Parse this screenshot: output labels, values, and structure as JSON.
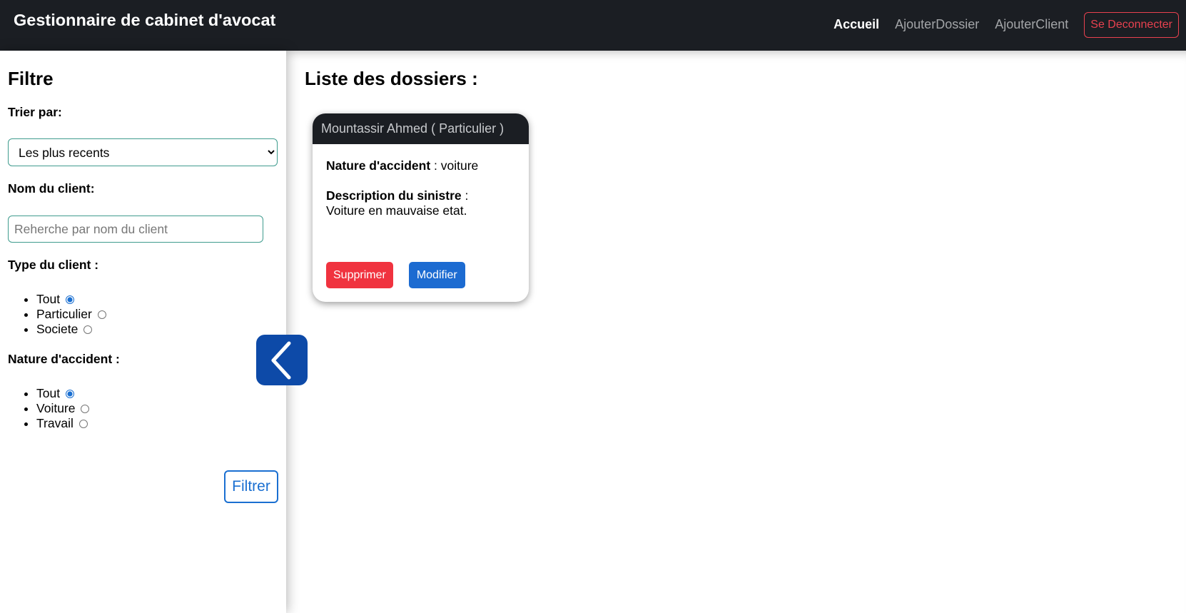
{
  "navbar": {
    "brand": "Gestionnaire de cabinet d'avocat",
    "links": [
      "Accueil",
      "AjouterDossier",
      "AjouterClient"
    ],
    "logout_label": "Se Deconnecter"
  },
  "sidebar": {
    "title": "Filtre",
    "sort_label": "Trier par:",
    "sort_value": "Les plus recents",
    "client_name_label": "Nom du client:",
    "search_placeholder": "Reherche par nom du client",
    "client_type_label": "Type du client :",
    "client_type_options": [
      "Tout",
      "Particulier",
      "Societe"
    ],
    "client_type_selected": "Tout",
    "accident_label": "Nature d'accident :",
    "accident_options": [
      "Tout",
      "Voiture",
      "Travail"
    ],
    "accident_selected": "Tout",
    "filter_button": "Filtrer",
    "toggle_icon": "chevron-left-icon"
  },
  "main": {
    "title": "Liste des dossiers :",
    "dossiers": [
      {
        "header": "Mountassir Ahmed ( Particulier )",
        "nature_label": "Nature d'accident",
        "nature_value": " : voiture",
        "description_label": "Description du sinistre",
        "description_sep": " :",
        "description_value": "Voiture en mauvaise etat.",
        "delete_label": "Supprimer",
        "edit_label": "Modifier"
      }
    ]
  },
  "colors": {
    "navbar_bg": "#1b1e23",
    "danger": "#f0333f",
    "primary": "#1c6bd1",
    "toggle_bg": "#0d4aa8",
    "input_border": "#3f9c8e"
  }
}
